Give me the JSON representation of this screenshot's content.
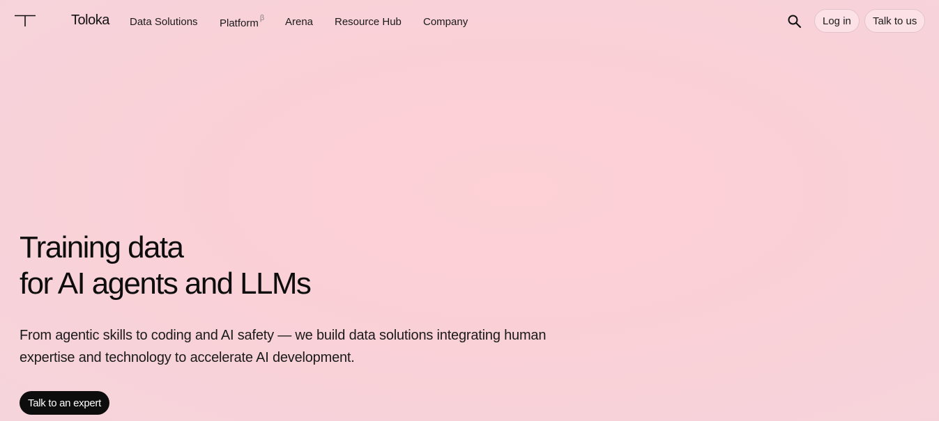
{
  "header": {
    "logo_icon": "toloka-t-logo-icon",
    "brand": "Toloka",
    "nav": [
      {
        "label": "Data Solutions"
      },
      {
        "label": "Platform",
        "badge": "β"
      },
      {
        "label": "Arena"
      },
      {
        "label": "Resource Hub"
      },
      {
        "label": "Company"
      }
    ],
    "search_icon": "search-icon",
    "login_label": "Log in",
    "talk_label": "Talk to us"
  },
  "hero": {
    "title_line1": "Training data",
    "title_line2": "for AI agents and LLMs",
    "subtitle": "From agentic skills to coding and AI safety — we build data solutions integrating human expertise and technology to accelerate AI development.",
    "cta_label": "Talk to an expert"
  },
  "colors": {
    "background": "#fbd0d6",
    "text": "#111111",
    "cta_background": "#0d0d0d",
    "cta_text": "#ffffff"
  }
}
